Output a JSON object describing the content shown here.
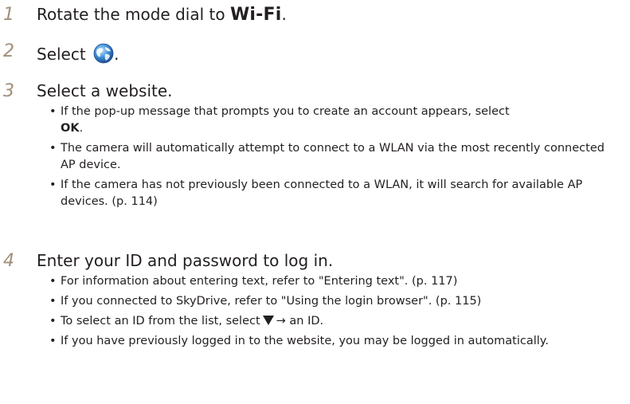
{
  "steps": [
    {
      "number": "1",
      "text": "Rotate the mode dial to ",
      "mode": "Wi-Fi",
      "end": "."
    },
    {
      "number": "2",
      "text": "Select ",
      "icon": "globe-icon",
      "end": "."
    },
    {
      "number": "3",
      "text": "Select a website."
    },
    {
      "number": "4",
      "text": "Enter your ID and password to log in."
    }
  ],
  "step3_bullets": {
    "b1_text": "If the pop-up message that prompts you to create an account appears, select",
    "b1_bold": "OK",
    "b1_end": ".",
    "b2": "The camera will automatically attempt to connect to a WLAN via the most recently connected AP device.",
    "b3": "If the camera has not previously been connected to a WLAN, it will search for available AP devices. (p. 114)"
  },
  "step4_bullets": {
    "b1": "For information about entering text, refer to \"Entering text\". (p. 117)",
    "b2": "If you connected to SkyDrive, refer to \"Using the login browser\". (p. 115)",
    "b3_before": "To select an ID from the list, select",
    "b3_icon": "down-triangle-icon",
    "b3_after": "→ an ID.",
    "b4": "If you have previously logged in to the website, you may be logged in automatically."
  }
}
